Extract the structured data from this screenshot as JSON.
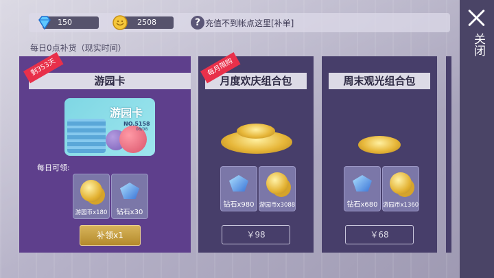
{
  "header": {
    "gem_amount": "150",
    "coin_amount": "2508",
    "help_text": "充值不到帐点这里[补单]"
  },
  "subtitle": "每日0点补货（现实时间）",
  "close_label": "关闭",
  "cards": [
    {
      "ribbon": "剩353天",
      "title": "游园卡",
      "pass": {
        "title": "游园卡",
        "number": "NO.5158",
        "date": "08/08"
      },
      "daily_label": "每日可领:",
      "rewards": [
        {
          "icon": "coin-icon",
          "label": "游园币x180"
        },
        {
          "icon": "diamond-icon",
          "label": "钻石x30"
        }
      ],
      "button_label": "补领x1"
    },
    {
      "ribbon": "每月限购",
      "title": "月度欢庆组合包",
      "rewards": [
        {
          "icon": "diamond-icon",
          "label": "钻石x980"
        },
        {
          "icon": "coin-icon",
          "label": "游园币x3088"
        }
      ],
      "price": "￥98"
    },
    {
      "title": "周末观光组合包",
      "rewards": [
        {
          "icon": "diamond-icon",
          "label": "钻石x680"
        },
        {
          "icon": "coin-icon",
          "label": "游园币x1360"
        }
      ],
      "price": "￥68"
    }
  ],
  "colors": {
    "ribbon": "#e8304a",
    "card_main": "#5e3f8c",
    "card_other": "#473e6a",
    "claim_button": "#c9a248"
  }
}
